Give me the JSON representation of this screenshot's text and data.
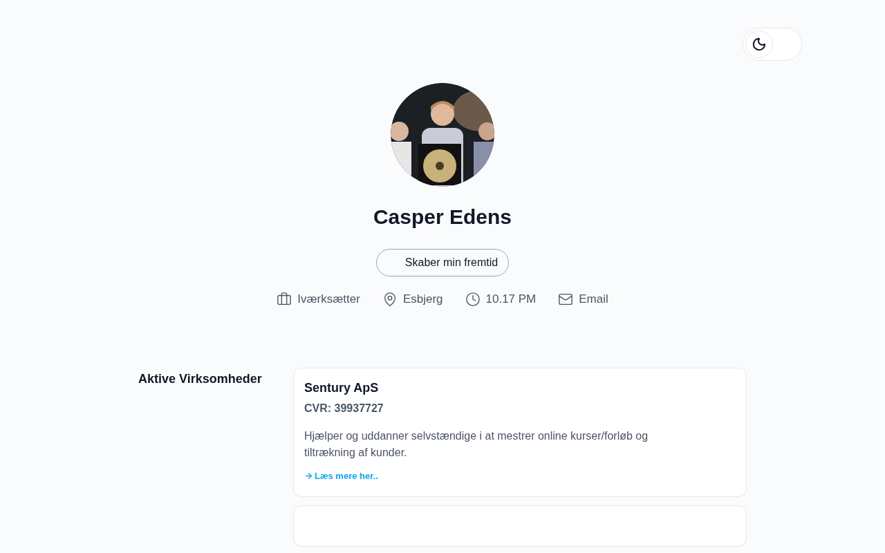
{
  "theme_toggle": {
    "on": false
  },
  "profile": {
    "name": "Casper Edens",
    "status": "Skaber min fremtid",
    "meta": [
      {
        "kind": "job",
        "text": "Iværksætter"
      },
      {
        "kind": "location",
        "text": "Esbjerg"
      },
      {
        "kind": "time",
        "text": "10.17 PM"
      },
      {
        "kind": "email",
        "text": "Email"
      }
    ]
  },
  "section": {
    "title": "Aktive Virksomheder",
    "companies": [
      {
        "name": "Sentury ApS",
        "cvr": "CVR: 39937727",
        "description": "Hjælper og uddanner selvstændige i at mestrer online kurser/forløb og tiltrækning af kunder.",
        "link": "Læs mere her.."
      }
    ]
  }
}
